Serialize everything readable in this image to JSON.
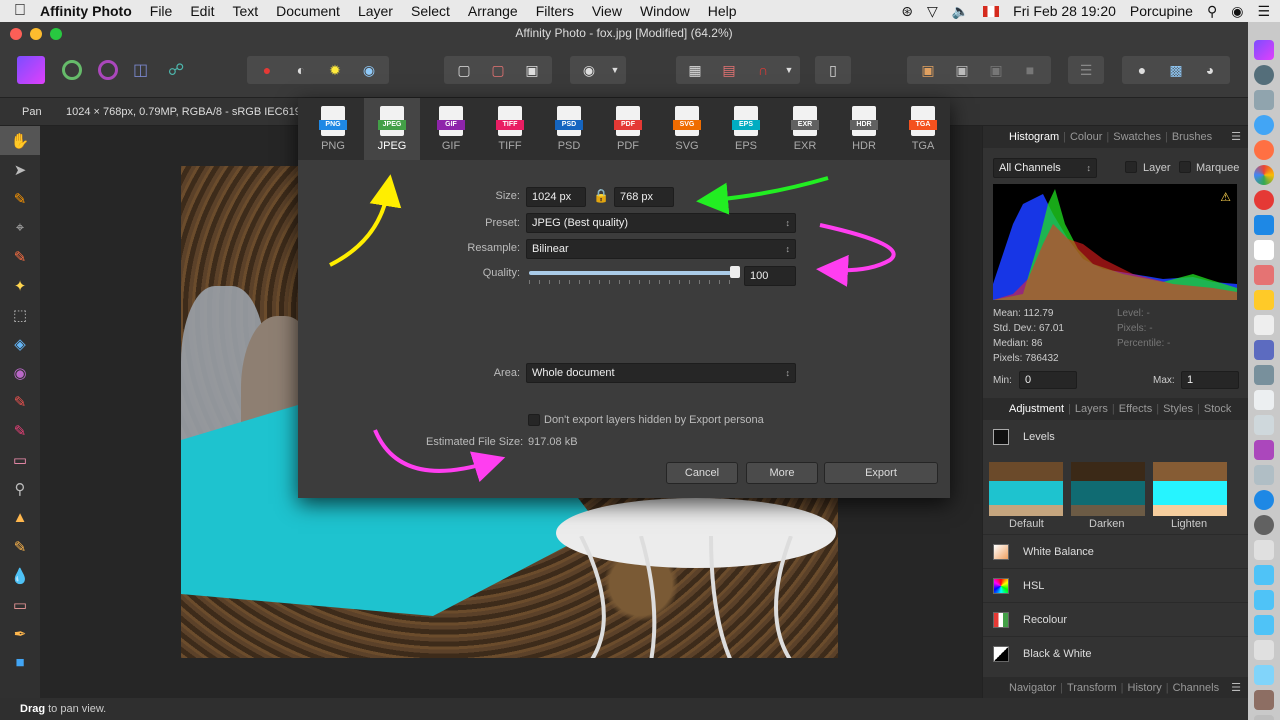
{
  "menubar": {
    "app": "Affinity Photo",
    "menus": [
      "File",
      "Edit",
      "Text",
      "Document",
      "Layer",
      "Select",
      "Arrange",
      "Filters",
      "View",
      "Window",
      "Help"
    ],
    "datetime": "Fri Feb 28  19:20",
    "user": "Porcupine"
  },
  "window": {
    "title": "Affinity Photo - fox.jpg [Modified] (64.2%)"
  },
  "context": {
    "tool": "Pan",
    "info": "1024 × 768px, 0.79MP, RGBA/8 - sRGB IEC6196"
  },
  "export": {
    "formats": [
      {
        "label": "PNG",
        "color": "#1e88e5"
      },
      {
        "label": "JPEG",
        "color": "#43a047"
      },
      {
        "label": "GIF",
        "color": "#8e24aa"
      },
      {
        "label": "TIFF",
        "color": "#e91e63"
      },
      {
        "label": "PSD",
        "color": "#1565c0"
      },
      {
        "label": "PDF",
        "color": "#e53935"
      },
      {
        "label": "SVG",
        "color": "#ef6c00"
      },
      {
        "label": "EPS",
        "color": "#00acc1"
      },
      {
        "label": "EXR",
        "color": "#616161"
      },
      {
        "label": "HDR",
        "color": "#616161"
      },
      {
        "label": "TGA",
        "color": "#f4511e"
      }
    ],
    "selected_format": "JPEG",
    "size_label": "Size:",
    "width": "1024 px",
    "height": "768 px",
    "preset_label": "Preset:",
    "preset": "JPEG (Best quality)",
    "resample_label": "Resample:",
    "resample": "Bilinear",
    "quality_label": "Quality:",
    "quality": "100",
    "area_label": "Area:",
    "area": "Whole document",
    "hidden_layers_label": "Don't export layers hidden by Export persona",
    "filesize_label": "Estimated File Size:",
    "filesize": "917.08 kB",
    "cancel": "Cancel",
    "more": "More",
    "export_btn": "Export"
  },
  "histogram_panel": {
    "tabs": [
      "Histogram",
      "Colour",
      "Swatches",
      "Brushes"
    ],
    "channels": "All Channels",
    "layer_label": "Layer",
    "marquee_label": "Marquee",
    "mean": "Mean: 112.79",
    "std": "Std. Dev.: 67.01",
    "median": "Median: 86",
    "pixels": "Pixels: 786432",
    "level": "Level: -",
    "pixels_r": "Pixels: -",
    "percentile": "Percentile: -",
    "min_label": "Min:",
    "min": "0",
    "max_label": "Max:",
    "max": "1"
  },
  "adjustment_panel": {
    "tabs": [
      "Adjustment",
      "Layers",
      "Effects",
      "Styles",
      "Stock"
    ],
    "levels": "Levels",
    "thumbs": [
      "Default",
      "Darken",
      "Lighten"
    ],
    "items": [
      "White Balance",
      "HSL",
      "Recolour",
      "Black & White"
    ]
  },
  "bottom_tabs": [
    "Navigator",
    "Transform",
    "History",
    "Channels"
  ],
  "status": {
    "bold": "Drag",
    "text": " to pan view."
  },
  "colors": {
    "arrow_yellow": "#ffee00",
    "arrow_green": "#22ee22",
    "arrow_magenta": "#ff3ef0",
    "accent_tarp": "#1ec3cf"
  }
}
